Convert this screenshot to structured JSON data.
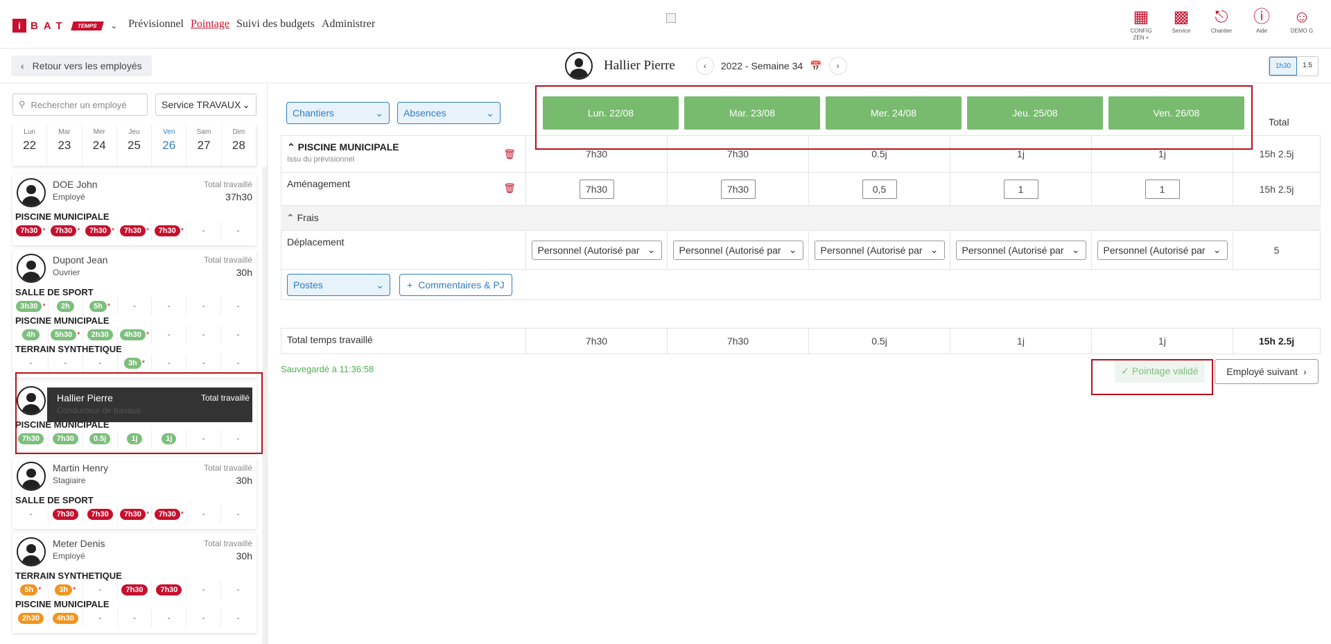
{
  "brand": {
    "i": "i",
    "letters": "BAT",
    "tag": "TEMPS"
  },
  "nav": [
    "Prévisionnel",
    "Pointage",
    "Suivi des budgets",
    "Administrer"
  ],
  "nav_active": 1,
  "top_icons": [
    {
      "icon": "building-icon",
      "label": "CONFIG ZEN +"
    },
    {
      "icon": "service-building-icon",
      "label": "Service"
    },
    {
      "icon": "crane-icon",
      "label": "Chantier"
    },
    {
      "icon": "help-icon",
      "label": "Aide"
    },
    {
      "icon": "user-icon",
      "label": "DEMO G"
    }
  ],
  "back_label": "Retour vers les employés",
  "employee_name": "Hallier Pierre",
  "week_label": "2022 - Semaine 34",
  "unit_toggle": [
    "1h30",
    "1.5"
  ],
  "search_placeholder": "Rechercher un employé",
  "service_label": "Service TRAVAUX",
  "days": [
    {
      "n": "Lun",
      "d": "22"
    },
    {
      "n": "Mar",
      "d": "23"
    },
    {
      "n": "Mer",
      "d": "24"
    },
    {
      "n": "Jeu",
      "d": "25"
    },
    {
      "n": "Ven",
      "d": "26",
      "current": true
    },
    {
      "n": "Sam",
      "d": "27"
    },
    {
      "n": "Dim",
      "d": "28"
    }
  ],
  "total_label": "Total travaillé",
  "employees": [
    {
      "name": "DOE John",
      "role": "Employé",
      "total": "37h30",
      "sites": [
        {
          "name": "PISCINE MUNICIPALE",
          "cells": [
            [
              "7h30",
              "red",
              true
            ],
            [
              "7h30",
              "red",
              true
            ],
            [
              "7h30",
              "red",
              true
            ],
            [
              "7h30",
              "red",
              true
            ],
            [
              "7h30",
              "red",
              true
            ],
            [
              "-"
            ],
            [
              "-"
            ]
          ]
        }
      ]
    },
    {
      "name": "Dupont Jean",
      "role": "Ouvrier",
      "total": "30h",
      "sites": [
        {
          "name": "SALLE DE SPORT",
          "cells": [
            [
              "3h30",
              "green",
              true
            ],
            [
              "2h",
              "green"
            ],
            [
              "5h",
              "green",
              true
            ],
            [
              "-"
            ],
            [
              "-"
            ],
            [
              "-"
            ],
            [
              "-"
            ]
          ]
        },
        {
          "name": "PISCINE MUNICIPALE",
          "cells": [
            [
              "4h",
              "green"
            ],
            [
              "5h30",
              "green",
              true
            ],
            [
              "2h30",
              "green"
            ],
            [
              "4h30",
              "green",
              true
            ],
            [
              "-"
            ],
            [
              "-"
            ],
            [
              "-"
            ]
          ]
        },
        {
          "name": "TERRAIN SYNTHETIQUE",
          "cells": [
            [
              "-"
            ],
            [
              "-"
            ],
            [
              "-"
            ],
            [
              "3h",
              "green",
              true
            ],
            [
              "-"
            ],
            [
              "-"
            ],
            [
              "-"
            ]
          ]
        }
      ]
    },
    {
      "name": "Hallier Pierre",
      "role": "Conducteur de travaux",
      "total": "15h 2.5j",
      "selected": true,
      "sites": [
        {
          "name": "PISCINE MUNICIPALE",
          "cells": [
            [
              "7h30",
              "green"
            ],
            [
              "7h30",
              "green"
            ],
            [
              "0.5j",
              "green"
            ],
            [
              "1j",
              "green"
            ],
            [
              "1j",
              "green"
            ],
            [
              "-"
            ],
            [
              "-"
            ]
          ]
        }
      ]
    },
    {
      "name": "Martin Henry",
      "role": "Stagiaire",
      "total": "30h",
      "sites": [
        {
          "name": "SALLE DE SPORT",
          "cells": [
            [
              "-"
            ],
            [
              "7h30",
              "red"
            ],
            [
              "7h30",
              "red"
            ],
            [
              "7h30",
              "red",
              true
            ],
            [
              "7h30",
              "red",
              true
            ],
            [
              "-"
            ],
            [
              "-"
            ]
          ]
        }
      ]
    },
    {
      "name": "Meter Denis",
      "role": "Employé",
      "total": "30h",
      "sites": [
        {
          "name": "TERRAIN SYNTHETIQUE",
          "cells": [
            [
              "5h",
              "orange",
              true
            ],
            [
              "3h",
              "orange",
              true
            ],
            [
              "-"
            ],
            [
              "7h30",
              "red"
            ],
            [
              "7h30",
              "red"
            ],
            [
              "-"
            ],
            [
              "-"
            ]
          ]
        },
        {
          "name": "PISCINE MUNICIPALE",
          "cells": [
            [
              "2h30",
              "orange"
            ],
            [
              "4h30",
              "orange"
            ],
            [
              "-"
            ],
            [
              "-"
            ],
            [
              "-"
            ],
            [
              "-"
            ],
            [
              "-"
            ]
          ]
        }
      ]
    }
  ],
  "filters": {
    "chantiers": "Chantiers",
    "absences": "Absences",
    "postes": "Postes",
    "comments": "Commentaires & PJ"
  },
  "day_headers": [
    "Lun. 22/08",
    "Mar. 23/08",
    "Mer. 24/08",
    "Jeu. 25/08",
    "Ven. 26/08"
  ],
  "total_header": "Total",
  "site_block": {
    "name": "PISCINE MUNICIPALE",
    "sub": "Issu du prévisionnel",
    "values": [
      "7h30",
      "7h30",
      "0.5j",
      "1j",
      "1j"
    ],
    "total": "15h 2.5j"
  },
  "task": {
    "name": "Aménagement",
    "inputs": [
      "7h30",
      "7h30",
      "0,5",
      "1",
      "1"
    ],
    "total": "15h 2.5j"
  },
  "frais_label": "Frais",
  "deplacement": {
    "name": "Déplacement",
    "option": "Personnel (Autorisé par",
    "total": "5"
  },
  "total_row": {
    "label": "Total temps travaillé",
    "values": [
      "7h30",
      "7h30",
      "0.5j",
      "1j",
      "1j"
    ],
    "total": "15h 2.5j"
  },
  "saved_text": "Sauvegardé à 11:36:58",
  "valid_label": "Pointage validé",
  "next_label": "Employé suivant",
  "colors": {
    "brand": "#c8102e",
    "accent": "#2d7fc7",
    "day_green": "#78bb6f"
  }
}
